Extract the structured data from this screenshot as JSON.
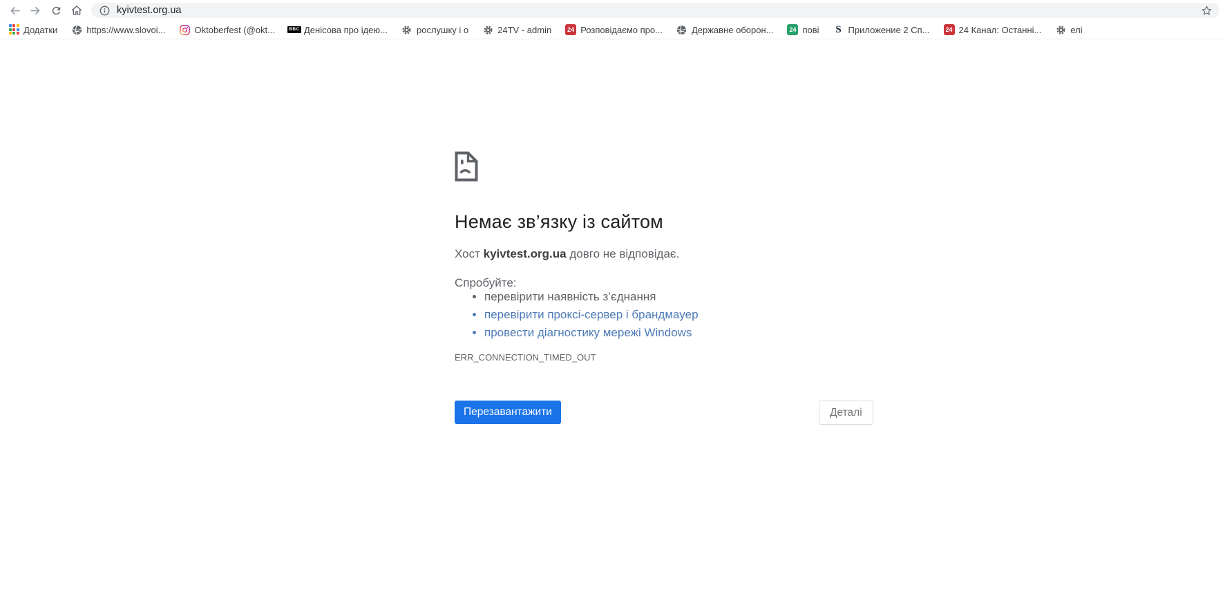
{
  "colors": {
    "accent": "#1a73e8",
    "link": "#4e7bb7",
    "title-text": "#202124",
    "body-text": "#5f6368",
    "toolbar-icon": "#5f6368",
    "disabled-icon": "#9aa0a6",
    "pill-bg": "#f1f3f4",
    "red-badge": "#cc343c",
    "green-badge": "#27a06a"
  },
  "toolbar": {
    "url": "kyivtest.org.ua"
  },
  "badge_text": "24",
  "bbc_text": "BBC",
  "s_text": "S",
  "bookmarks": [
    {
      "label": "Додатки",
      "icon": "apps-grid"
    },
    {
      "label": "https://www.slovoi...",
      "icon": "globe"
    },
    {
      "label": "Oktoberfest (@okt...",
      "icon": "instagram"
    },
    {
      "label": "Денісова про ідею...",
      "icon": "bbc"
    },
    {
      "label": "рослушку і о",
      "icon": "gear"
    },
    {
      "label": "24TV - admin",
      "icon": "gear"
    },
    {
      "label": "Розповідаємо про...",
      "icon": "badge-24-red"
    },
    {
      "label": "Державне оборон...",
      "icon": "globe"
    },
    {
      "label": "пові",
      "icon": "badge-24-green"
    },
    {
      "label": "Приложение 2 Сп...",
      "icon": "letter-s"
    },
    {
      "label": "24 Канал: Останні...",
      "icon": "badge-24-red"
    },
    {
      "label": "елі",
      "icon": "gear"
    }
  ],
  "error_page": {
    "title": "Немає зв’язку із сайтом",
    "host_prefix": "Хост ",
    "host": "kyivtest.org.ua",
    "host_suffix": " довго не відповідає.",
    "try_label": "Спробуйте:",
    "suggestions": [
      {
        "text": "перевірити наявність з’єднання",
        "is_link": false
      },
      {
        "text": "перевірити проксі-сервер і брандмауер",
        "is_link": true
      },
      {
        "text": "провести діагностику мережі Windows",
        "is_link": true
      }
    ],
    "error_code": "ERR_CONNECTION_TIMED_OUT",
    "reload_button": "Перезавантажити",
    "details_button": "Деталі"
  }
}
